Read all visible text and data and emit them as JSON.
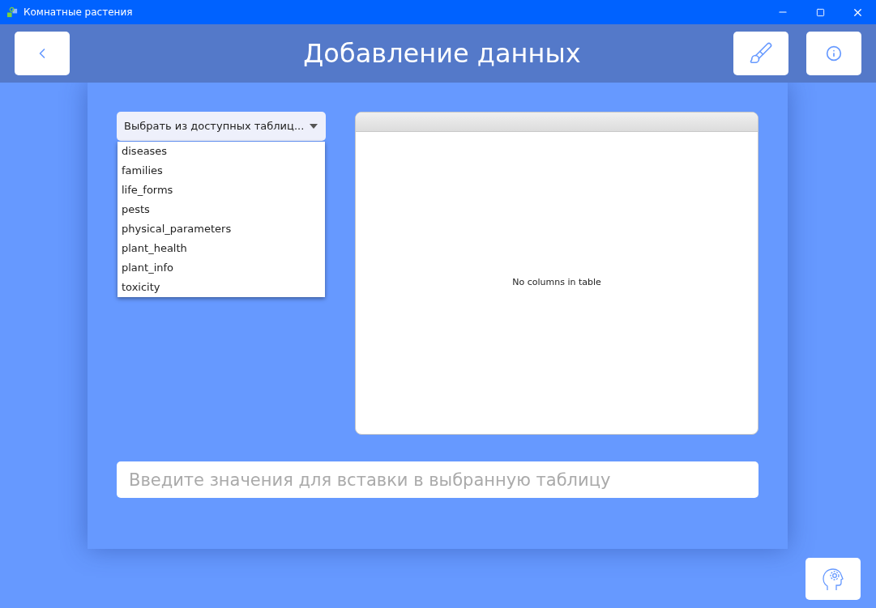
{
  "window": {
    "title": "Комнатные растения"
  },
  "header": {
    "title": "Добавление данных"
  },
  "table_select": {
    "placeholder": "Выбрать из доступных таблиц...",
    "expanded": true,
    "options": [
      "diseases",
      "families",
      "life_forms",
      "pests",
      "physical_parameters",
      "plant_health",
      "plant_info",
      "toxicity"
    ]
  },
  "table": {
    "empty_message": "No columns in table"
  },
  "values_input": {
    "placeholder": "Введите значения для вставки в выбранную таблицу"
  }
}
